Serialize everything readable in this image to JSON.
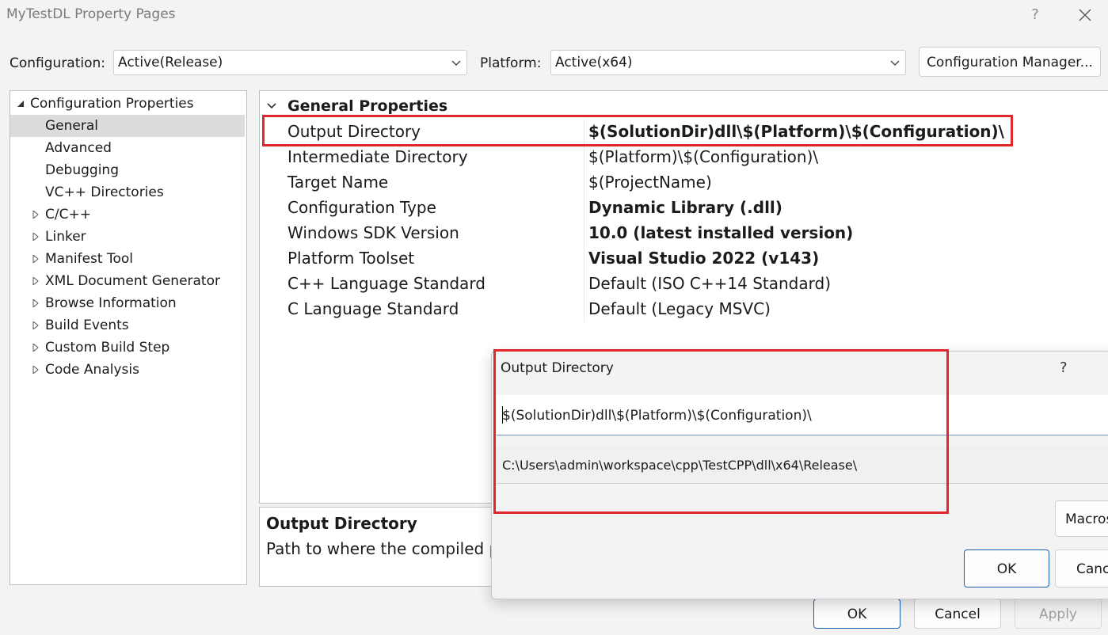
{
  "window": {
    "title": "MyTestDL Property Pages",
    "help": "?"
  },
  "toolbar": {
    "configuration_label": "Configuration:",
    "configuration_value": "Active(Release)",
    "platform_label": "Platform:",
    "platform_value": "Active(x64)",
    "config_manager": "Configuration Manager..."
  },
  "tree": {
    "root": "Configuration Properties",
    "items": [
      {
        "label": "General",
        "expandable": false,
        "selected": true
      },
      {
        "label": "Advanced",
        "expandable": false
      },
      {
        "label": "Debugging",
        "expandable": false
      },
      {
        "label": "VC++ Directories",
        "expandable": false
      },
      {
        "label": "C/C++",
        "expandable": true
      },
      {
        "label": "Linker",
        "expandable": true
      },
      {
        "label": "Manifest Tool",
        "expandable": true
      },
      {
        "label": "XML Document Generator",
        "expandable": true
      },
      {
        "label": "Browse Information",
        "expandable": true
      },
      {
        "label": "Build Events",
        "expandable": true
      },
      {
        "label": "Custom Build Step",
        "expandable": true
      },
      {
        "label": "Code Analysis",
        "expandable": true
      }
    ]
  },
  "grid": {
    "section": "General Properties",
    "rows": [
      {
        "name": "Output Directory",
        "value": "$(SolutionDir)dll\\$(Platform)\\$(Configuration)\\",
        "bold": true
      },
      {
        "name": "Intermediate Directory",
        "value": "$(Platform)\\$(Configuration)\\",
        "bold": false
      },
      {
        "name": "Target Name",
        "value": "$(ProjectName)",
        "bold": false
      },
      {
        "name": "Configuration Type",
        "value": "Dynamic Library (.dll)",
        "bold": true
      },
      {
        "name": "Windows SDK Version",
        "value": "10.0 (latest installed version)",
        "bold": true
      },
      {
        "name": "Platform Toolset",
        "value": "Visual Studio 2022 (v143)",
        "bold": true
      },
      {
        "name": "C++ Language Standard",
        "value": "Default (ISO C++14 Standard)",
        "bold": false
      },
      {
        "name": "C Language Standard",
        "value": "Default (Legacy MSVC)",
        "bold": false
      }
    ]
  },
  "description": {
    "title": "Output Directory",
    "body": "Path to where the compiled p"
  },
  "footer": {
    "ok": "OK",
    "cancel": "Cancel",
    "apply": "Apply"
  },
  "dialog": {
    "title": "Output Directory",
    "help": "?",
    "edit_value": "$(SolutionDir)dll\\$(Platform)\\$(Configuration)\\",
    "evaluated_value": "C:\\Users\\admin\\workspace\\cpp\\TestCPP\\dll\\x64\\Release\\",
    "macros": "Macros",
    "ok": "OK",
    "cancel": "Canc"
  },
  "colors": {
    "highlight": "#e0282c",
    "selection": "#dcdcdc",
    "primary_border": "#1b5fb5"
  }
}
